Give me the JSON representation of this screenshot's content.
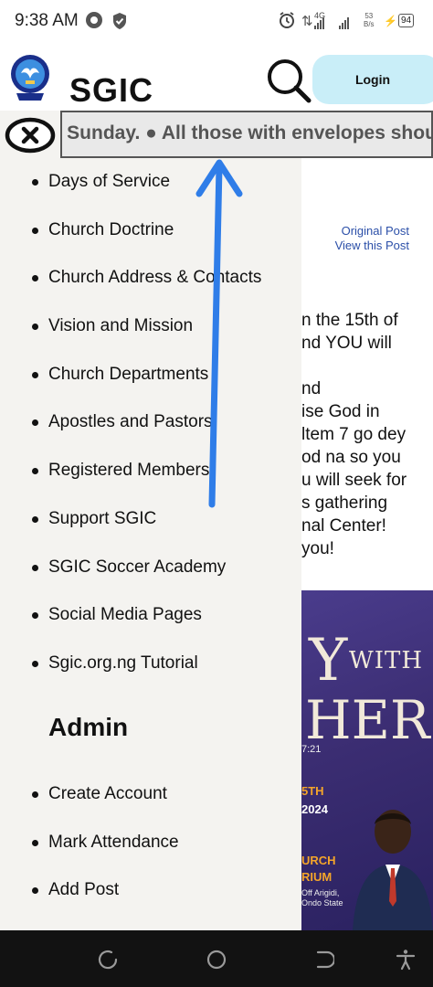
{
  "status_bar": {
    "time": "9:38 AM",
    "network1": "4G",
    "network2": "",
    "net_speed_value": "53",
    "net_speed_unit": "B/s",
    "battery": "94",
    "icons": [
      "chrome-icon",
      "shield-icon",
      "alarm-icon",
      "vibrate-icon",
      "signal-icon",
      "battery-icon"
    ]
  },
  "header": {
    "title": "SGIC",
    "login_label": "Login",
    "login_bg": "#c9eef8"
  },
  "ticker": {
    "text": "this Sunday. ● All those with envelopes should"
  },
  "post": {
    "original_post": "Original Post",
    "view_post": "View this Post",
    "lines": [
      "n the 15th of",
      "nd YOU will",
      "",
      "nd",
      "ise God in",
      "ltem 7 go dey",
      "od na so you",
      "u will seek for",
      "s gathering",
      "nal Center!",
      "you!"
    ]
  },
  "flyer": {
    "big1": "Y",
    "with": "WITH",
    "big2": "HER",
    "ref": "7:21",
    "date1": "5TH",
    "date2": "2024",
    "venue1": "URCH",
    "venue2": "RIUM",
    "addr1": "Off Arigidi,",
    "addr2": "Ondo State"
  },
  "menu": {
    "items": [
      "Days of Service",
      "Church Doctrine",
      "Church Address & Contacts",
      "Vision and Mission",
      "Church Departments",
      "Apostles and Pastors",
      "Registered Members",
      "Support SGIC",
      "SGIC Soccer Academy",
      "Social Media Pages",
      "Sgic.org.ng Tutorial"
    ],
    "admin_title": "Admin",
    "admin_items": [
      "Create Account",
      "Mark Attendance",
      "Add Post"
    ]
  },
  "colors": {
    "menu_bg": "#f4f3f0",
    "arrow": "#2f7de8",
    "link": "#2b4fa8",
    "nav_bar": "#121212"
  }
}
